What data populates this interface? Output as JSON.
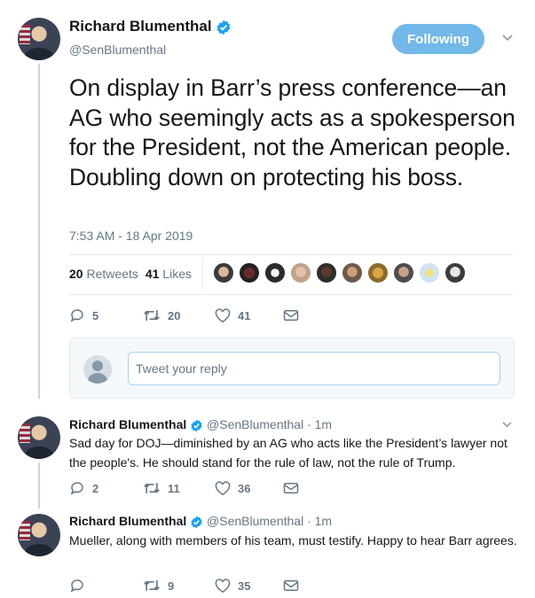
{
  "main_tweet": {
    "author_name": "Richard Blumenthal",
    "author_handle": "@SenBlumenthal",
    "follow_label": "Following",
    "text": "On display in Barr’s press conference—an AG who seemingly acts as a spokesperson for the President, not the American people. Doubling down on protecting his boss.",
    "timestamp": "7:53 AM - 18 Apr 2019",
    "retweets_count": "20",
    "retweets_label": "Retweets",
    "likes_count": "41",
    "likes_label": "Likes",
    "actions": {
      "reply": "5",
      "retweet": "20",
      "like": "41"
    }
  },
  "reply_box": {
    "placeholder": "Tweet your reply"
  },
  "replies": [
    {
      "author_name": "Richard Blumenthal",
      "author_handle": "@SenBlumenthal",
      "time": "· 1m",
      "text": "Sad day for DOJ—diminished by an AG who acts like the President’s lawyer not the people's. He should stand for the rule of law, not the rule of Trump.",
      "actions": {
        "reply": "2",
        "retweet": "11",
        "like": "36"
      }
    },
    {
      "author_name": "Richard Blumenthal",
      "author_handle": "@SenBlumenthal",
      "time": "· 1m",
      "text": "Mueller, along with members of his team, must testify. Happy to hear Barr agrees.",
      "actions": {
        "reply": "",
        "retweet": "9",
        "like": "35"
      }
    }
  ],
  "colors": {
    "accent": "#1da1f2",
    "follow_button": "#72b8e8",
    "muted": "#657786",
    "border": "#e6ecf0"
  }
}
